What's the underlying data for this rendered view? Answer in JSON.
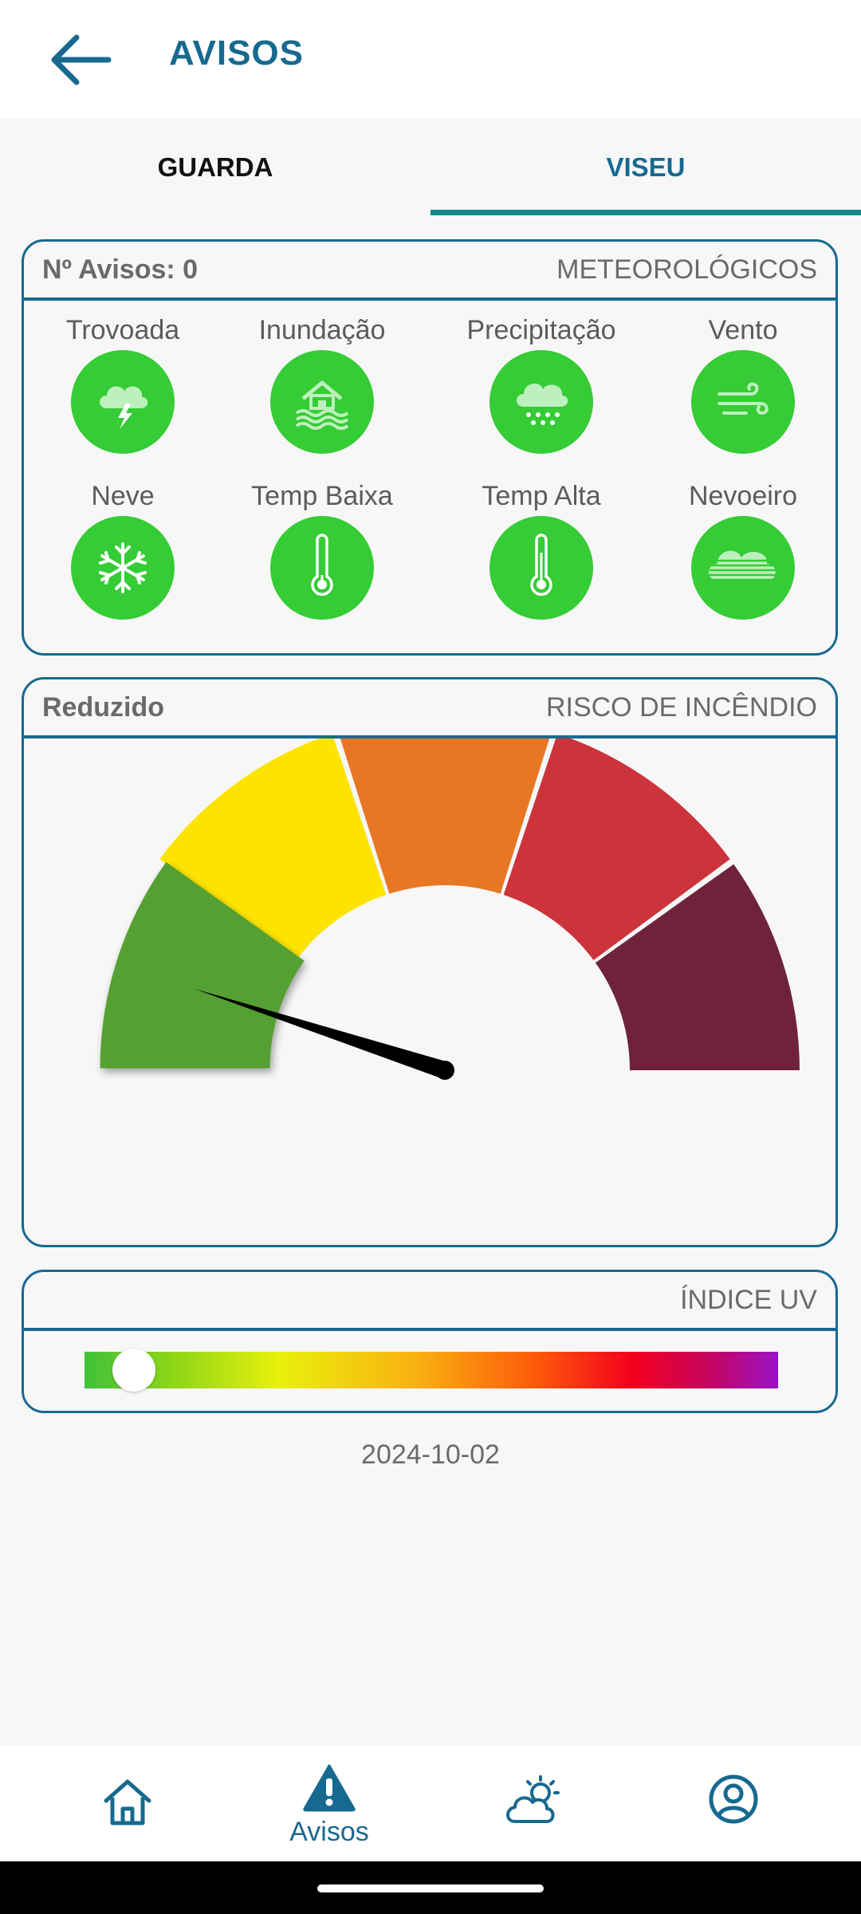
{
  "app": {
    "title": "AVISOS"
  },
  "tabs": [
    {
      "label": "GUARDA"
    },
    {
      "label": "VISEU"
    }
  ],
  "selected_tab": "VISEU",
  "warnings_card": {
    "count_label": "Nº Avisos: 0",
    "category": "METEOROLÓGICOS",
    "items": [
      {
        "label": "Trovoada",
        "icon": "thunderstorm-icon"
      },
      {
        "label": "Inundação",
        "icon": "flood-icon"
      },
      {
        "label": "Precipitação",
        "icon": "rain-icon"
      },
      {
        "label": "Vento",
        "icon": "wind-icon"
      },
      {
        "label": "Neve",
        "icon": "snow-icon"
      },
      {
        "label": "Temp Baixa",
        "icon": "thermometer-low-icon"
      },
      {
        "label": "Temp Alta",
        "icon": "thermometer-high-icon"
      },
      {
        "label": "Nevoeiro",
        "icon": "fog-icon"
      }
    ],
    "status_color": "#35cc35"
  },
  "fire_card": {
    "level": "Reduzido",
    "category": "RISCO DE INCÊNDIO",
    "gauge_segments": [
      {
        "color": "#55a030"
      },
      {
        "color": "#fde400"
      },
      {
        "color": "#e87724"
      },
      {
        "color": "#cc333a"
      },
      {
        "color": "#6f233a"
      }
    ],
    "active_segment": 1
  },
  "uv_card": {
    "category": "ÍNDICE UV",
    "level_fraction": 0.05
  },
  "date": "2024-10-02",
  "bottom_nav": {
    "items": [
      {
        "icon": "home-icon",
        "label": ""
      },
      {
        "icon": "warning-icon",
        "label": "Avisos"
      },
      {
        "icon": "weather-icon",
        "label": ""
      },
      {
        "icon": "profile-icon",
        "label": ""
      }
    ],
    "active": "Avisos"
  },
  "colors": {
    "accent": "#17698f",
    "tab_indicator": "#0f8a86"
  }
}
